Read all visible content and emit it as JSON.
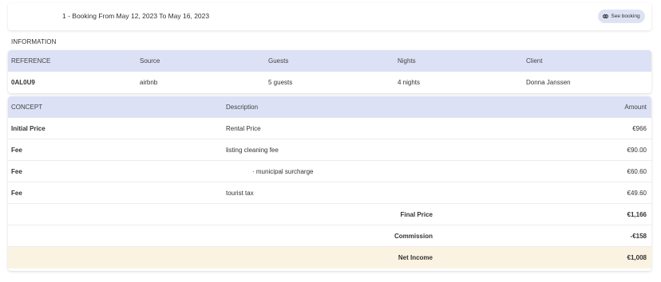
{
  "header": {
    "title": "1 - Booking From May 12, 2023 To May 16, 2023",
    "see_booking_label": "See booking"
  },
  "information": {
    "label": "INFORMATION",
    "columns": [
      "REFERENCE",
      "Source",
      "Guests",
      "Nights",
      "Client"
    ],
    "row": [
      "0AL0U9",
      "airbnb",
      "5 guests",
      "4 nights",
      "Donna Janssen"
    ]
  },
  "concepts": {
    "columns": [
      "CONCEPT",
      "Description",
      "Amount"
    ],
    "rows": [
      {
        "concept": "Initial Price",
        "description": "Rental Price",
        "amount": "€966"
      },
      {
        "concept": "Fee",
        "description": "listing cleaning fee",
        "amount": "€90.00"
      },
      {
        "concept": "Fee",
        "description": "· municipal surcharge",
        "amount": "€60.60"
      },
      {
        "concept": "Fee",
        "description": "tourist tax",
        "amount": "€49.60"
      }
    ],
    "totals": [
      {
        "label": "Final Price",
        "amount": "€1,166"
      },
      {
        "label": "Commission",
        "amount": "-€158"
      },
      {
        "label": "Net Income",
        "amount": "€1,008"
      }
    ]
  },
  "colors": {
    "header_row_bg": "#dde1f6",
    "net_income_bg": "#fbf3e2",
    "button_bg": "#dde3f3"
  },
  "icons": {
    "see_booking": "link-icon"
  }
}
